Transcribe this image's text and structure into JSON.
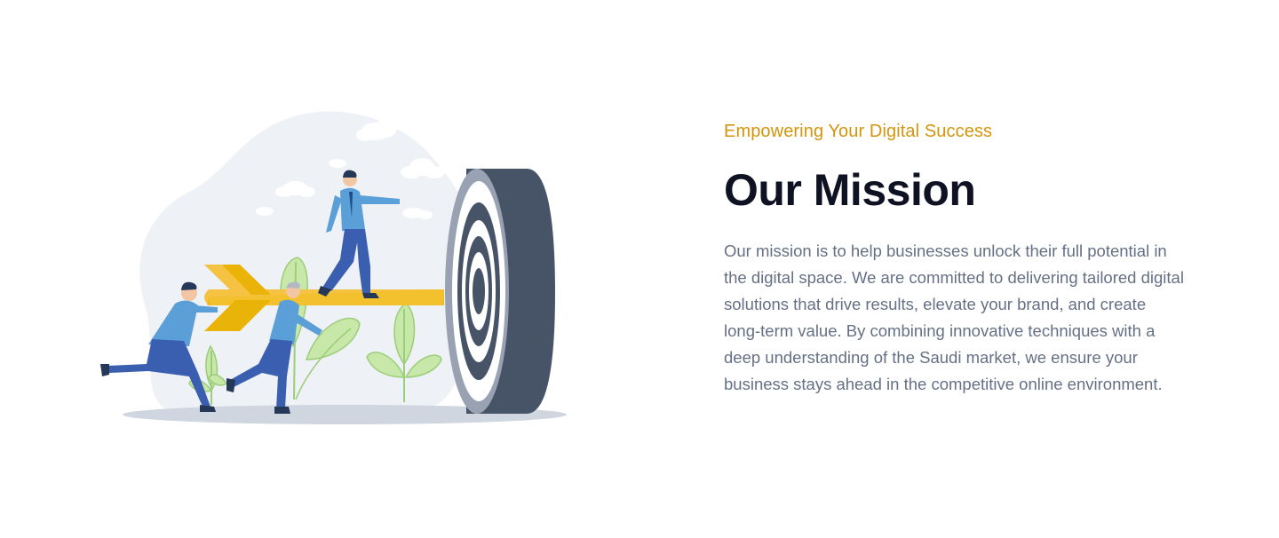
{
  "mission": {
    "eyebrow": "Empowering Your Digital Success",
    "title": "Our Mission",
    "body": "Our mission is to help businesses unlock their full potential in the digital space. We are committed to delivering tailored digital solutions that drive results, elevate your brand, and create long-term value. By combining innovative techniques with a deep understanding of the Saudi market, we ensure your business stays ahead in the competitive online environment."
  },
  "colors": {
    "accent": "#d4940c",
    "heading": "#0f1222",
    "body": "#667085",
    "target_dark": "#475467",
    "dart_yellow": "#eab308",
    "figure_blue": "#3b82c4",
    "leaf_green": "#c7e8a8"
  },
  "illustration": {
    "icon": "dart-target-team-illustration"
  }
}
